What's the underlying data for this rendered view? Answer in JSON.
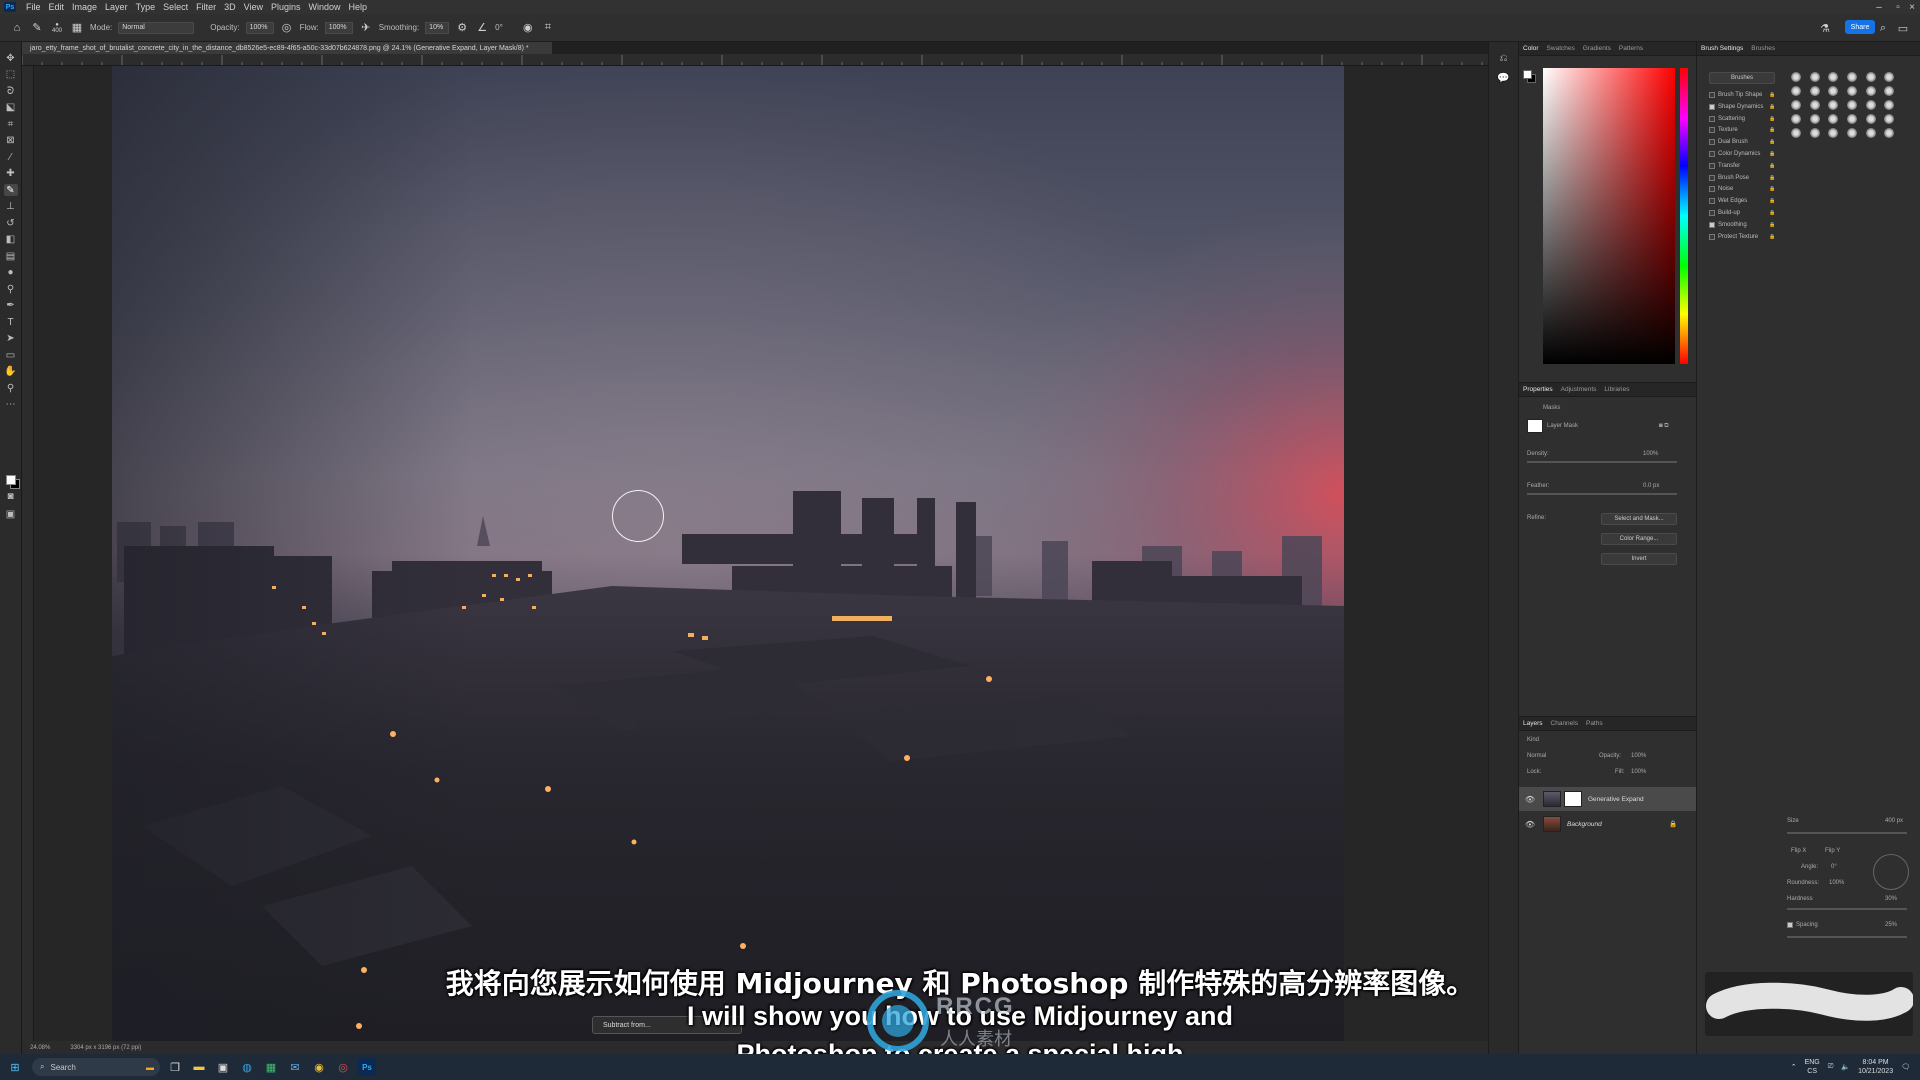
{
  "menubar": {
    "app_logo": "Ps",
    "items": [
      "File",
      "Edit",
      "Image",
      "Layer",
      "Type",
      "Select",
      "Filter",
      "3D",
      "View",
      "Plugins",
      "Window",
      "Help"
    ],
    "window_controls": [
      "minimize-icon",
      "restore-icon",
      "close-icon"
    ]
  },
  "options_bar": {
    "mode_label": "Mode:",
    "mode_value": "Normal",
    "opacity_label": "Opacity:",
    "opacity_value": "100%",
    "flow_label": "Flow:",
    "flow_value": "100%",
    "smoothing_label": "Smoothing:",
    "smoothing_value": "10%",
    "angle_value": "0°",
    "share_label": "Share",
    "brush_size": "400"
  },
  "document": {
    "tab_title": "jaro_etty_frame_shot_of_brutalist_concrete_city_in_the_distance_db8526e5-ec89-4f65-a50c-33d07b624878.png @ 24.1% (Generative Expand, Layer Mask/8) *",
    "zoom": "24.08%",
    "doc_size": "3304 px x 3196 px (72 ppi)"
  },
  "context_bar": {
    "subtract_label": "Subtract from..."
  },
  "color_panel": {
    "tabs": [
      "Color",
      "Swatches",
      "Gradients",
      "Patterns"
    ],
    "active_tab": "Color",
    "foreground": "#ffffff",
    "background": "#000000"
  },
  "properties_panel": {
    "tabs": [
      "Properties",
      "Adjustments",
      "Libraries"
    ],
    "section_title": "Masks",
    "mask_label": "Layer Mask",
    "density_label": "Density:",
    "density_value": "100%",
    "feather_label": "Feather:",
    "feather_value": "0.0 px",
    "refine_label": "Refine:",
    "btn_select_mask": "Select and Mask...",
    "btn_color_range": "Color Range...",
    "btn_invert": "Invert"
  },
  "layers_panel": {
    "tabs": [
      "Layers",
      "Channels",
      "Paths"
    ],
    "filter_label": "Kind",
    "blend_mode": "Normal",
    "opacity_label": "Opacity:",
    "opacity_value": "100%",
    "lock_label": "Lock:",
    "fill_label": "Fill:",
    "fill_value": "100%",
    "layers": [
      {
        "name": "Generative Expand",
        "selected": true
      },
      {
        "name": "Background",
        "selected": false
      }
    ]
  },
  "brush_settings": {
    "tabs": [
      "Brush Settings",
      "Brushes"
    ],
    "brushes_button": "Brushes",
    "items": [
      {
        "label": "Brush Tip Shape",
        "checked": false
      },
      {
        "label": "Shape Dynamics",
        "checked": true
      },
      {
        "label": "Scattering",
        "checked": false
      },
      {
        "label": "Texture",
        "checked": false
      },
      {
        "label": "Dual Brush",
        "checked": false
      },
      {
        "label": "Color Dynamics",
        "checked": false
      },
      {
        "label": "Transfer",
        "checked": false
      },
      {
        "label": "Brush Pose",
        "checked": false
      },
      {
        "label": "Noise",
        "checked": false
      },
      {
        "label": "Wet Edges",
        "checked": false
      },
      {
        "label": "Build-up",
        "checked": false
      },
      {
        "label": "Smoothing",
        "checked": true
      },
      {
        "label": "Protect Texture",
        "checked": false
      }
    ],
    "size_label": "Size",
    "size_value": "400 px",
    "flip_x": "Flip X",
    "flip_y": "Flip Y",
    "angle_label": "Angle:",
    "angle_value": "0°",
    "roundness_label": "Roundness:",
    "roundness_value": "100%",
    "hardness_label": "Hardness",
    "hardness_value": "30%",
    "spacing_label": "Spacing",
    "spacing_value": "25%"
  },
  "subtitles": {
    "zh": "我将向您展示如何使用 Midjourney 和 Photoshop 制作特殊的高分辨率图像。",
    "en_line1": "I will show you how to use Midjourney and",
    "en_line2": "Photoshop to create a special high"
  },
  "watermark": {
    "brand": "RRCG",
    "sub": "人人素材"
  },
  "taskbar": {
    "search_label": "Search",
    "lang_line1": "ENG",
    "lang_line2": "CS",
    "time": "8:04 PM",
    "date": "10/21/2023"
  }
}
